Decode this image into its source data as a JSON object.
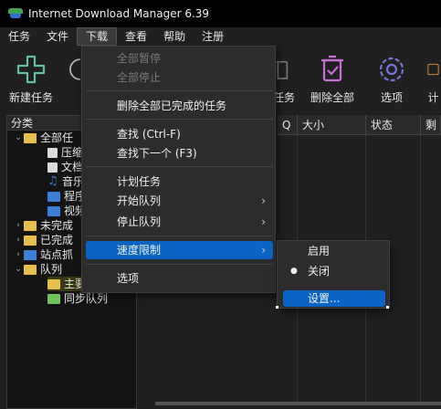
{
  "app": {
    "title": "Internet Download Manager 6.39"
  },
  "menubar": [
    "任务",
    "文件",
    "下载",
    "查看",
    "帮助",
    "注册"
  ],
  "toolbar": {
    "new_task": "新建任务",
    "delete_task_partial": "任务",
    "delete_all": "删除全部",
    "options": "选项",
    "scheduler_partial": "计"
  },
  "left_panel": {
    "header": "分类",
    "tree": {
      "all": "全部任",
      "compressed": "压缩",
      "documents": "文档",
      "music": "音乐",
      "programs": "程序",
      "video": "视频",
      "unfinished": "未完成",
      "finished": "已完成",
      "grabber": "站点抓",
      "queues": "队列",
      "main_queue": "主要",
      "sync_queue": "同步队列"
    }
  },
  "columns": {
    "q": "Q",
    "size": "大小",
    "status": "状态",
    "remain": "剩"
  },
  "download_menu": {
    "pause_all": "全部暂停",
    "stop_all": "全部停止",
    "delete_completed": "删除全部已完成的任务",
    "find": "查找 (Ctrl-F)",
    "find_next": "查找下一个 (F3)",
    "scheduler": "计划任务",
    "start_queue": "开始队列",
    "stop_queue": "停止队列",
    "speed_limit": "速度限制",
    "options": "选项"
  },
  "speed_submenu": {
    "enable": "启用",
    "disable": "关闭",
    "settings": "设置..."
  }
}
